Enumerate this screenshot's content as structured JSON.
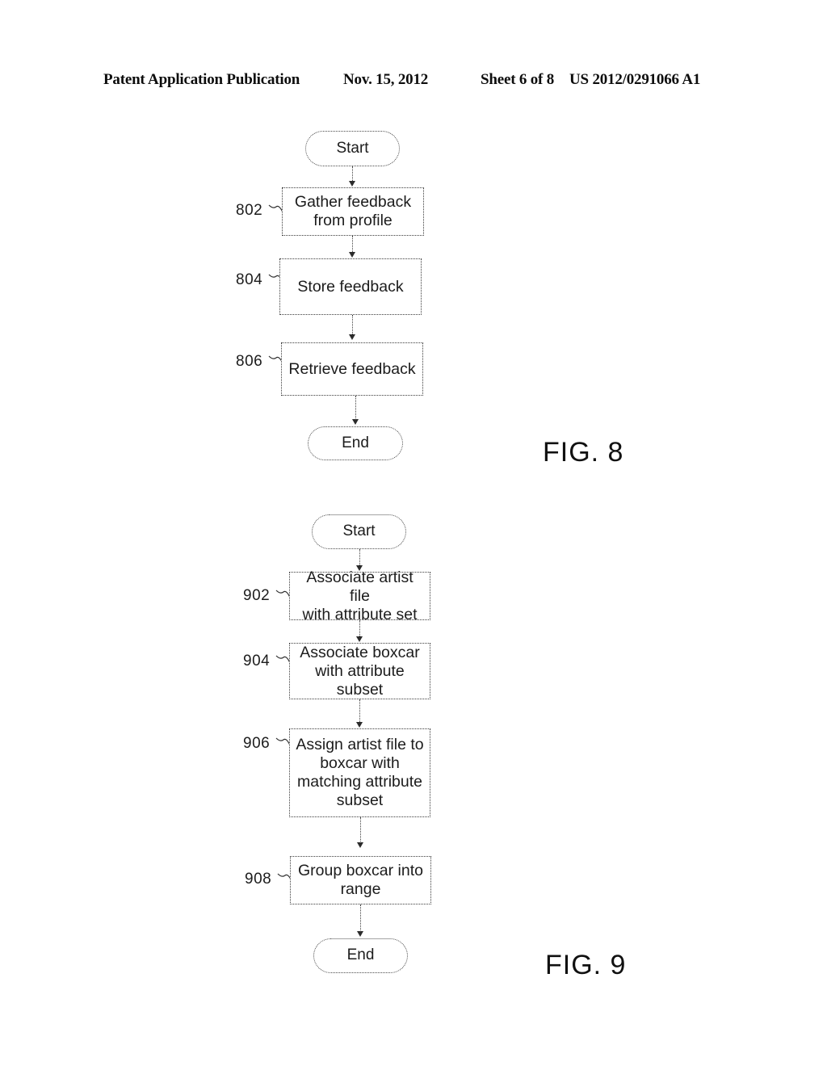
{
  "header": {
    "publication": "Patent Application Publication",
    "date": "Nov. 15, 2012",
    "sheet": "Sheet 6 of 8",
    "patent_number": "US 2012/0291066 A1"
  },
  "figures": [
    {
      "caption": "FIG. 8",
      "nodes": [
        {
          "id": "fig8-start",
          "type": "terminator",
          "label": "Start"
        },
        {
          "id": "fig8-802",
          "type": "process",
          "ref": "802",
          "label": "Gather feedback\nfrom profile",
          "lines": [
            "Gather feedback",
            "from profile"
          ]
        },
        {
          "id": "fig8-804",
          "type": "process",
          "ref": "804",
          "label": "Store feedback",
          "lines": [
            "Store feedback"
          ]
        },
        {
          "id": "fig8-806",
          "type": "process",
          "ref": "806",
          "label": "Retrieve feedback",
          "lines": [
            "Retrieve feedback"
          ]
        },
        {
          "id": "fig8-end",
          "type": "terminator",
          "label": "End"
        }
      ]
    },
    {
      "caption": "FIG. 9",
      "nodes": [
        {
          "id": "fig9-start",
          "type": "terminator",
          "label": "Start"
        },
        {
          "id": "fig9-902",
          "type": "process",
          "ref": "902",
          "label": "Associate artist file\nwith attribute set",
          "lines": [
            "Associate artist file",
            "with attribute set"
          ]
        },
        {
          "id": "fig9-904",
          "type": "process",
          "ref": "904",
          "label": "Associate boxcar\nwith attribute\nsubset",
          "lines": [
            "Associate boxcar",
            "with attribute",
            "subset"
          ]
        },
        {
          "id": "fig9-906",
          "type": "process",
          "ref": "906",
          "label": "Assign artist file to\nboxcar with\nmatching attribute\nsubset",
          "lines": [
            "Assign artist file to",
            "boxcar with",
            "matching attribute",
            "subset"
          ]
        },
        {
          "id": "fig9-908",
          "type": "process",
          "ref": "908",
          "label": "Group boxcar into\nrange",
          "lines": [
            "Group boxcar into",
            "range"
          ]
        },
        {
          "id": "fig9-end",
          "type": "terminator",
          "label": "End"
        }
      ]
    }
  ],
  "fig8": {
    "start_label": "Start",
    "end_label": "End",
    "caption": "FIG. 8",
    "step802": {
      "ref": "802",
      "line1": "Gather feedback",
      "line2": "from profile"
    },
    "step804": {
      "ref": "804",
      "line1": "Store feedback"
    },
    "step806": {
      "ref": "806",
      "line1": "Retrieve feedback"
    }
  },
  "fig9": {
    "start_label": "Start",
    "end_label": "End",
    "caption": "FIG. 9",
    "step902": {
      "ref": "902",
      "line1": "Associate artist file",
      "line2": "with attribute set"
    },
    "step904": {
      "ref": "904",
      "line1": "Associate boxcar",
      "line2": "with attribute",
      "line3": "subset"
    },
    "step906": {
      "ref": "906",
      "line1": "Assign artist file to",
      "line2": "boxcar with",
      "line3": "matching attribute",
      "line4": "subset"
    },
    "step908": {
      "ref": "908",
      "line1": "Group boxcar into",
      "line2": "range"
    }
  },
  "colors": {
    "ink": "#1a1a1a",
    "paper": "#ffffff",
    "line": "#3f3f3f"
  }
}
